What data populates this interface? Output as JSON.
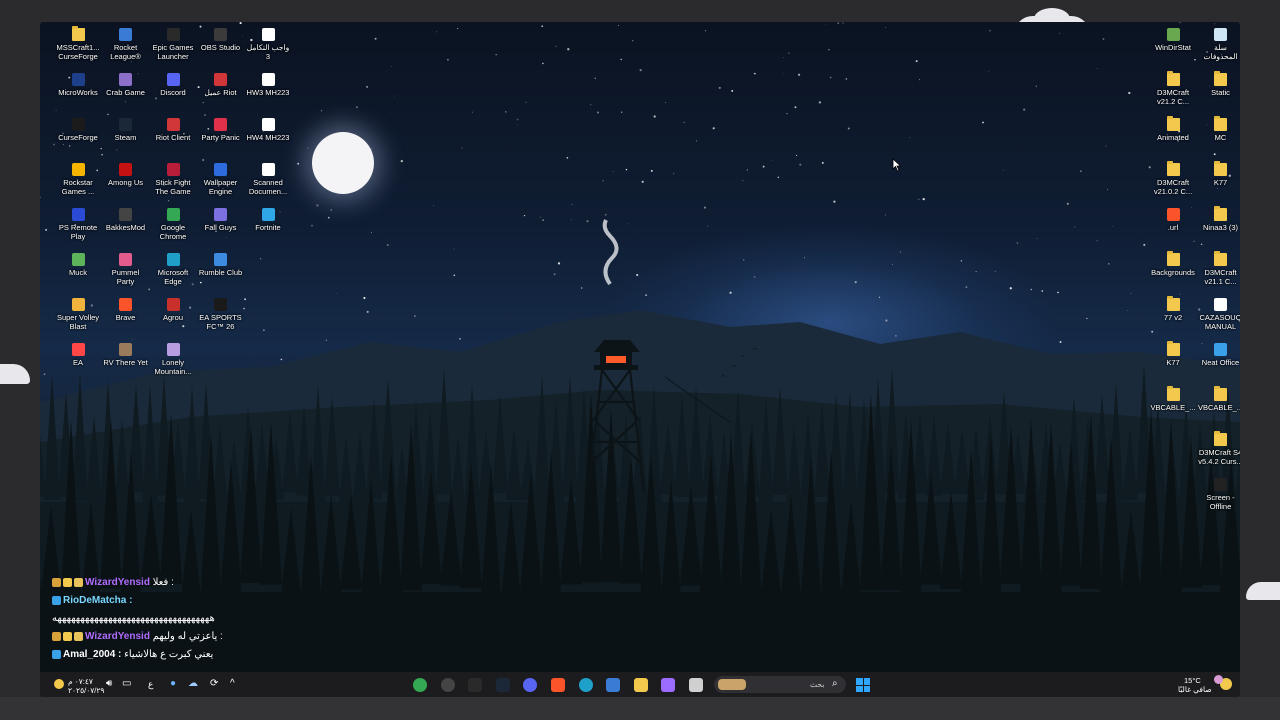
{
  "desktop": {
    "left_icons": [
      {
        "label": "MSSCraft1... CurseForge",
        "icon": "folder-icon",
        "color": "#f2c94c",
        "col": 0,
        "row": 0
      },
      {
        "label": "Rocket League®",
        "icon": "rocket-league-icon",
        "color": "#3a7bd5",
        "col": 1,
        "row": 0
      },
      {
        "label": "Epic Games Launcher",
        "icon": "epic-games-icon",
        "color": "#2a2a2a",
        "col": 2,
        "row": 0
      },
      {
        "label": "OBS Studio",
        "icon": "obs-icon",
        "color": "#3b3b3b",
        "col": 3,
        "row": 0
      },
      {
        "label": "واجب التكامل 3",
        "icon": "document-icon",
        "color": "#ffffff",
        "col": 4,
        "row": 0
      },
      {
        "label": "MicroWorks",
        "icon": "microworks-icon",
        "color": "#1e3f8a",
        "col": 0,
        "row": 1
      },
      {
        "label": "Crab Game",
        "icon": "crab-game-icon",
        "color": "#8b6fc9",
        "col": 1,
        "row": 1
      },
      {
        "label": "Discord",
        "icon": "discord-icon",
        "color": "#5865f2",
        "col": 2,
        "row": 1
      },
      {
        "label": "عميل Riot",
        "icon": "riot-icon",
        "color": "#d13639",
        "col": 3,
        "row": 1
      },
      {
        "label": "HW3 MH223",
        "icon": "document-icon",
        "color": "#ffffff",
        "col": 4,
        "row": 1
      },
      {
        "label": "CurseForge",
        "icon": "curseforge-icon",
        "color": "#1b1b1b",
        "col": 0,
        "row": 2
      },
      {
        "label": "Steam",
        "icon": "steam-icon",
        "color": "#1b2838",
        "col": 1,
        "row": 2
      },
      {
        "label": "Riot Client",
        "icon": "riot-icon",
        "color": "#d13639",
        "col": 2,
        "row": 2
      },
      {
        "label": "Party Panic",
        "icon": "party-panic-icon",
        "color": "#e0314b",
        "col": 3,
        "row": 2
      },
      {
        "label": "HW4 MH223",
        "icon": "document-icon",
        "color": "#ffffff",
        "col": 4,
        "row": 2
      },
      {
        "label": "Rockstar Games ...",
        "icon": "rockstar-icon",
        "color": "#f4b400",
        "col": 0,
        "row": 3
      },
      {
        "label": "Among Us",
        "icon": "among-us-icon",
        "color": "#c51111",
        "col": 1,
        "row": 3
      },
      {
        "label": "Stick Fight The Game",
        "icon": "stick-fight-icon",
        "color": "#b81d3a",
        "col": 2,
        "row": 3
      },
      {
        "label": "Wallpaper Engine",
        "icon": "wallpaper-engine-icon",
        "color": "#2d6cdf",
        "col": 3,
        "row": 3
      },
      {
        "label": "Scanned Documen...",
        "icon": "document-icon",
        "color": "#ffffff",
        "col": 4,
        "row": 3
      },
      {
        "label": "PS Remote Play",
        "icon": "ps-remote-icon",
        "color": "#2b4bd6",
        "col": 0,
        "row": 4
      },
      {
        "label": "BakkesMod",
        "icon": "bakkesmod-icon",
        "color": "#444444",
        "col": 1,
        "row": 4
      },
      {
        "label": "Google Chrome",
        "icon": "chrome-icon",
        "color": "#34a853",
        "col": 2,
        "row": 4
      },
      {
        "label": "Fall Guys",
        "icon": "fall-guys-icon",
        "color": "#7c6fe0",
        "col": 3,
        "row": 4
      },
      {
        "label": "Fortnite",
        "icon": "fortnite-icon",
        "color": "#2fa6e6",
        "col": 4,
        "row": 4
      },
      {
        "label": "Muck",
        "icon": "muck-icon",
        "color": "#5db35a",
        "col": 0,
        "row": 5
      },
      {
        "label": "Pummel Party",
        "icon": "pummel-party-icon",
        "color": "#e35b8c",
        "col": 1,
        "row": 5
      },
      {
        "label": "Microsoft Edge",
        "icon": "edge-icon",
        "color": "#1fa0c9",
        "col": 2,
        "row": 5
      },
      {
        "label": "Rumble Club",
        "icon": "rumble-club-icon",
        "color": "#3d8be0",
        "col": 3,
        "row": 5
      },
      {
        "label": "Super Volley Blast",
        "icon": "super-volley-icon",
        "color": "#f0b43c",
        "col": 0,
        "row": 6
      },
      {
        "label": "Brave",
        "icon": "brave-icon",
        "color": "#fb542b",
        "col": 1,
        "row": 6
      },
      {
        "label": "Agrou",
        "icon": "agrou-icon",
        "color": "#c9302c",
        "col": 2,
        "row": 6
      },
      {
        "label": "EA SPORTS FC™ 26",
        "icon": "ea-fc-icon",
        "color": "#1a1a1a",
        "col": 3,
        "row": 6
      },
      {
        "label": "EA",
        "icon": "ea-icon",
        "color": "#ff4747",
        "col": 0,
        "row": 7
      },
      {
        "label": "RV There Yet",
        "icon": "rv-there-yet-icon",
        "color": "#9a7b5c",
        "col": 1,
        "row": 7
      },
      {
        "label": "Lonely Mountain...",
        "icon": "lonely-mountains-icon",
        "color": "#b89ee0",
        "col": 2,
        "row": 7
      }
    ],
    "right_icons": [
      {
        "label": "WinDirStat",
        "icon": "windirstat-icon",
        "color": "#6aa84f",
        "col": 0,
        "row": 0
      },
      {
        "label": "سلة المحذوفات",
        "icon": "recycle-bin-icon",
        "color": "#cfe6f7",
        "col": 1,
        "row": 0
      },
      {
        "label": "D3MCraft v21.2 C...",
        "icon": "folder-icon",
        "color": "#f2c94c",
        "col": 0,
        "row": 1
      },
      {
        "label": "Static",
        "icon": "folder-icon",
        "color": "#f2c94c",
        "col": 1,
        "row": 1
      },
      {
        "label": "Animated",
        "icon": "folder-icon",
        "color": "#f2c94c",
        "col": 0,
        "row": 2
      },
      {
        "label": "MC",
        "icon": "folder-icon",
        "color": "#f2c94c",
        "col": 1,
        "row": 2
      },
      {
        "label": "D3MCraft v21.0.2 C...",
        "icon": "folder-icon",
        "color": "#f2c94c",
        "col": 0,
        "row": 3
      },
      {
        "label": "K77",
        "icon": "folder-icon",
        "color": "#f2c94c",
        "col": 1,
        "row": 3
      },
      {
        "label": ".url",
        "icon": "brave-icon",
        "color": "#fb542b",
        "col": 0,
        "row": 4
      },
      {
        "label": "Ninaa3 (3)",
        "icon": "folder-icon",
        "color": "#f2c94c",
        "col": 1,
        "row": 4
      },
      {
        "label": "Backgrounds",
        "icon": "folder-icon",
        "color": "#f2c94c",
        "col": 0,
        "row": 5
      },
      {
        "label": "D3MCraft v21.1 C...",
        "icon": "folder-icon",
        "color": "#f2c94c",
        "col": 1,
        "row": 5
      },
      {
        "label": "77 v2",
        "icon": "folder-icon",
        "color": "#f2c94c",
        "col": 0,
        "row": 6
      },
      {
        "label": "CAZASOUQ MANUAL",
        "icon": "document-icon",
        "color": "#ffffff",
        "col": 1,
        "row": 6
      },
      {
        "label": "K77",
        "icon": "folder-icon",
        "color": "#f2c94c",
        "col": 0,
        "row": 7
      },
      {
        "label": "Neat Office",
        "icon": "neat-office-icon",
        "color": "#3aa0e8",
        "col": 1,
        "row": 7
      },
      {
        "label": "VBCABLE_...",
        "icon": "folder-icon",
        "color": "#f2c94c",
        "col": 0,
        "row": 8
      },
      {
        "label": "VBCABLE_...",
        "icon": "folder-icon",
        "color": "#f2c94c",
        "col": 1,
        "row": 8
      },
      {
        "label": "D3MCraft S4 v5.4.2 Curs...",
        "icon": "folder-icon",
        "color": "#f2c94c",
        "col": 1,
        "row": 9
      },
      {
        "label": "Screen - Offline",
        "icon": "screen-offline-icon",
        "color": "#222222",
        "col": 1,
        "row": 10
      }
    ]
  },
  "chat": [
    {
      "user": "WizardYensid",
      "user_color": "#b06cff",
      "message": "فعلا :",
      "badges": true
    },
    {
      "user": "RioDeMatcha :",
      "user_color": "#7ad7ff",
      "message": "",
      "badges": false
    },
    {
      "user": "",
      "user_color": "#ffffff",
      "message": "ههههههههههههههههههههههههههههههههههه",
      "badges": false
    },
    {
      "user": "WizardYensid",
      "user_color": "#b06cff",
      "message": "ياعزتي له وليهم :",
      "badges": true
    },
    {
      "user": "Amal_2004 :",
      "user_color": "#ffffff",
      "message": "يعني كبرت ع هالاشياء",
      "badges": false
    }
  ],
  "taskbar": {
    "clock_time": "٠٧:٤٧ م",
    "clock_date": "٢٠٢٥/٠٧/٢٩",
    "lang": "ع",
    "search_placeholder": "بحث",
    "weather_temp": "15°C",
    "weather_text": "صافي غالبًا",
    "pinned": [
      {
        "name": "chrome-icon",
        "color": "#34a853"
      },
      {
        "name": "obs-icon",
        "color": "#444444"
      },
      {
        "name": "epic-games-icon",
        "color": "#2a2a2a"
      },
      {
        "name": "steam-icon",
        "color": "#1b2838"
      },
      {
        "name": "discord-icon",
        "color": "#5865f2"
      },
      {
        "name": "brave-icon",
        "color": "#fb542b"
      },
      {
        "name": "edge-icon",
        "color": "#1fa0c9"
      },
      {
        "name": "store-icon",
        "color": "#3a7bd5"
      },
      {
        "name": "file-explorer-icon",
        "color": "#f2c94c"
      },
      {
        "name": "copilot-icon",
        "color": "#9b6cff"
      },
      {
        "name": "task-view-icon",
        "color": "#d0d0d0"
      }
    ]
  },
  "colors": {
    "accent_purple": "#b06cff",
    "folder_yellow": "#f2c94c",
    "taskbar_bg": "#1c1c1f",
    "windows_blue": "#2fa6ff"
  }
}
